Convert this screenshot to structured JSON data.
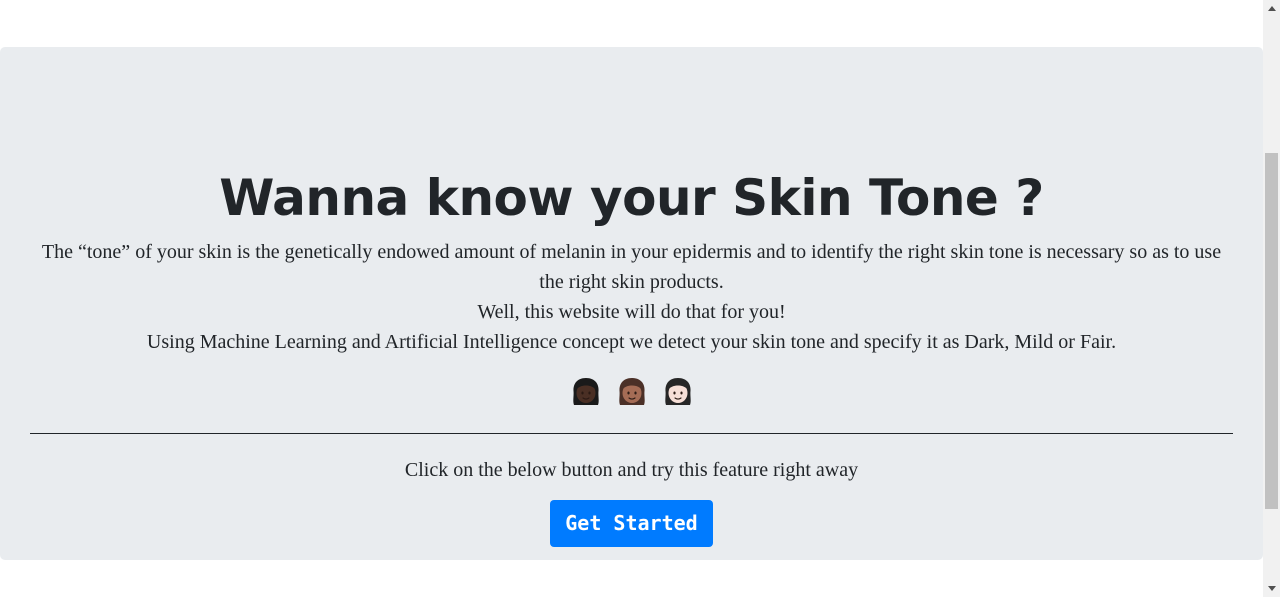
{
  "hero": {
    "title": "Wanna know your Skin Tone ?",
    "paragraph_1": "The “tone” of your skin is the genetically endowed amount of melanin in your epidermis and to identify the right skin tone is necessary so as to use the right skin products.",
    "paragraph_2": "Well, this website will do that for you!",
    "paragraph_3": "Using Machine Learning and Artificial Intelligence concept we detect your skin tone and specify it as Dark, Mild or Fair."
  },
  "emojis": [
    {
      "icon": "woman-dark-skin-tone-icon",
      "skin": "#4a2f24",
      "hair": "#1a1a1a"
    },
    {
      "icon": "woman-medium-skin-tone-icon",
      "skin": "#a56c55",
      "hair": "#4b3027"
    },
    {
      "icon": "woman-light-skin-tone-icon",
      "skin": "#f7dfd7",
      "hair": "#262626"
    }
  ],
  "cta": {
    "text": "Click on the below button and try this feature right away",
    "button_label": "Get Started"
  },
  "colors": {
    "jumbotron_bg": "#e9ecef",
    "text": "#212529",
    "button_bg": "#007bff",
    "button_text": "#ffffff"
  }
}
